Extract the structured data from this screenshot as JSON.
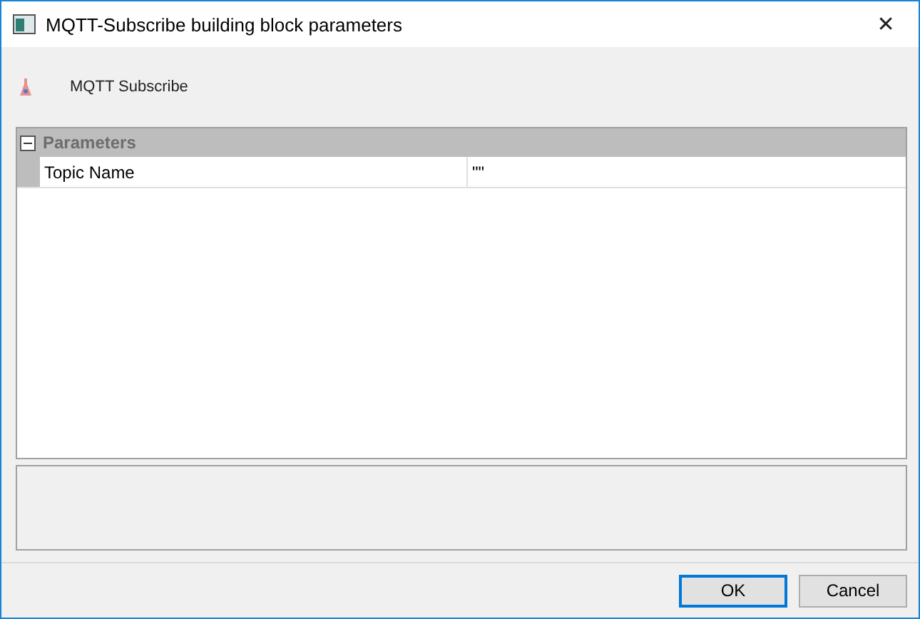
{
  "window": {
    "title": "MQTT-Subscribe building block parameters",
    "close": "✕"
  },
  "header": {
    "label": "MQTT Subscribe"
  },
  "parameters": {
    "category": "Parameters",
    "expanded": true,
    "rows": [
      {
        "name": "Topic Name",
        "value": "\"\""
      }
    ]
  },
  "buttons": [
    {
      "label": "OK",
      "default": true
    },
    {
      "label": "Cancel",
      "default": false
    }
  ]
}
